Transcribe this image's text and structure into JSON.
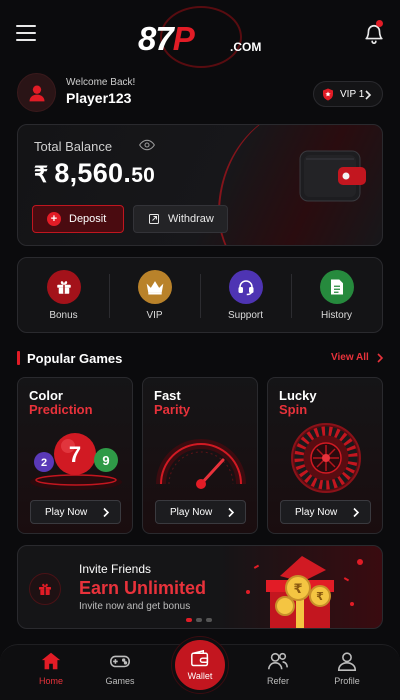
{
  "header": {
    "logo_main": "87",
    "logo_p": "P",
    "logo_sub": ".COM"
  },
  "user": {
    "welcome": "Welcome Back!",
    "username": "Player123",
    "vip_label": "VIP 1"
  },
  "balance": {
    "label": "Total Balance",
    "currency_symbol": "₹",
    "amount_main": "8,560.",
    "amount_decimal": "50",
    "deposit_label": "Deposit",
    "withdraw_label": "Withdraw"
  },
  "quick_actions": [
    {
      "label": "Bonus",
      "icon": "gift-icon",
      "color": "#b3141c"
    },
    {
      "label": "VIP",
      "icon": "crown-icon",
      "color": "#c8902a"
    },
    {
      "label": "Support",
      "icon": "headset-icon",
      "color": "#5b3fc4"
    },
    {
      "label": "History",
      "icon": "document-icon",
      "color": "#2f9a47"
    }
  ],
  "popular_games": {
    "title": "Popular Games",
    "view_all": "View All",
    "games": [
      {
        "line1": "Color",
        "line2": "Prediction",
        "button": "Play Now"
      },
      {
        "line1": "Fast",
        "line2": "Parity",
        "button": "Play Now"
      },
      {
        "line1": "Lucky",
        "line2": "Spin",
        "button": "Play Now"
      }
    ],
    "balls": [
      "2",
      "7",
      "9"
    ]
  },
  "invite": {
    "title": "Invite Friends",
    "headline": "Earn Unlimited",
    "subtitle": "Invite now and get bonus",
    "coin_symbol": "₹"
  },
  "nav": {
    "home": "Home",
    "games": "Games",
    "wallet": "Wallet",
    "refer": "Refer",
    "profile": "Profile"
  },
  "colors": {
    "accent": "#e21c26",
    "background": "#0b0b0d",
    "card": "#141416"
  }
}
